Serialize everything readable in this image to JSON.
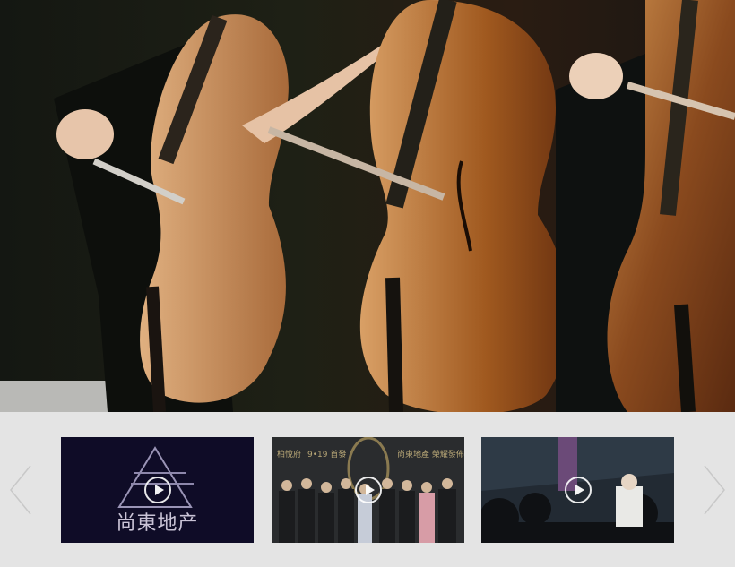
{
  "hero": {
    "image": "cello-ensemble-photo"
  },
  "carousel": {
    "prev_icon": "chevron-left-icon",
    "next_icon": "chevron-right-icon",
    "items": [
      {
        "thumbnail": "shangdong-logo-thumbnail",
        "caption": "尚東地产",
        "icon": "play-icon"
      },
      {
        "thumbnail": "launch-event-thumbnail",
        "caption_left": "柏悅府",
        "caption_mid": "9•19 首發",
        "caption_right": "尚東地產 榮耀發佈",
        "icon": "play-icon"
      },
      {
        "thumbnail": "concert-hall-thumbnail",
        "icon": "play-icon"
      }
    ]
  },
  "colors": {
    "strip_background": "#e4e4e4",
    "arrow": "#c8c8c8"
  }
}
